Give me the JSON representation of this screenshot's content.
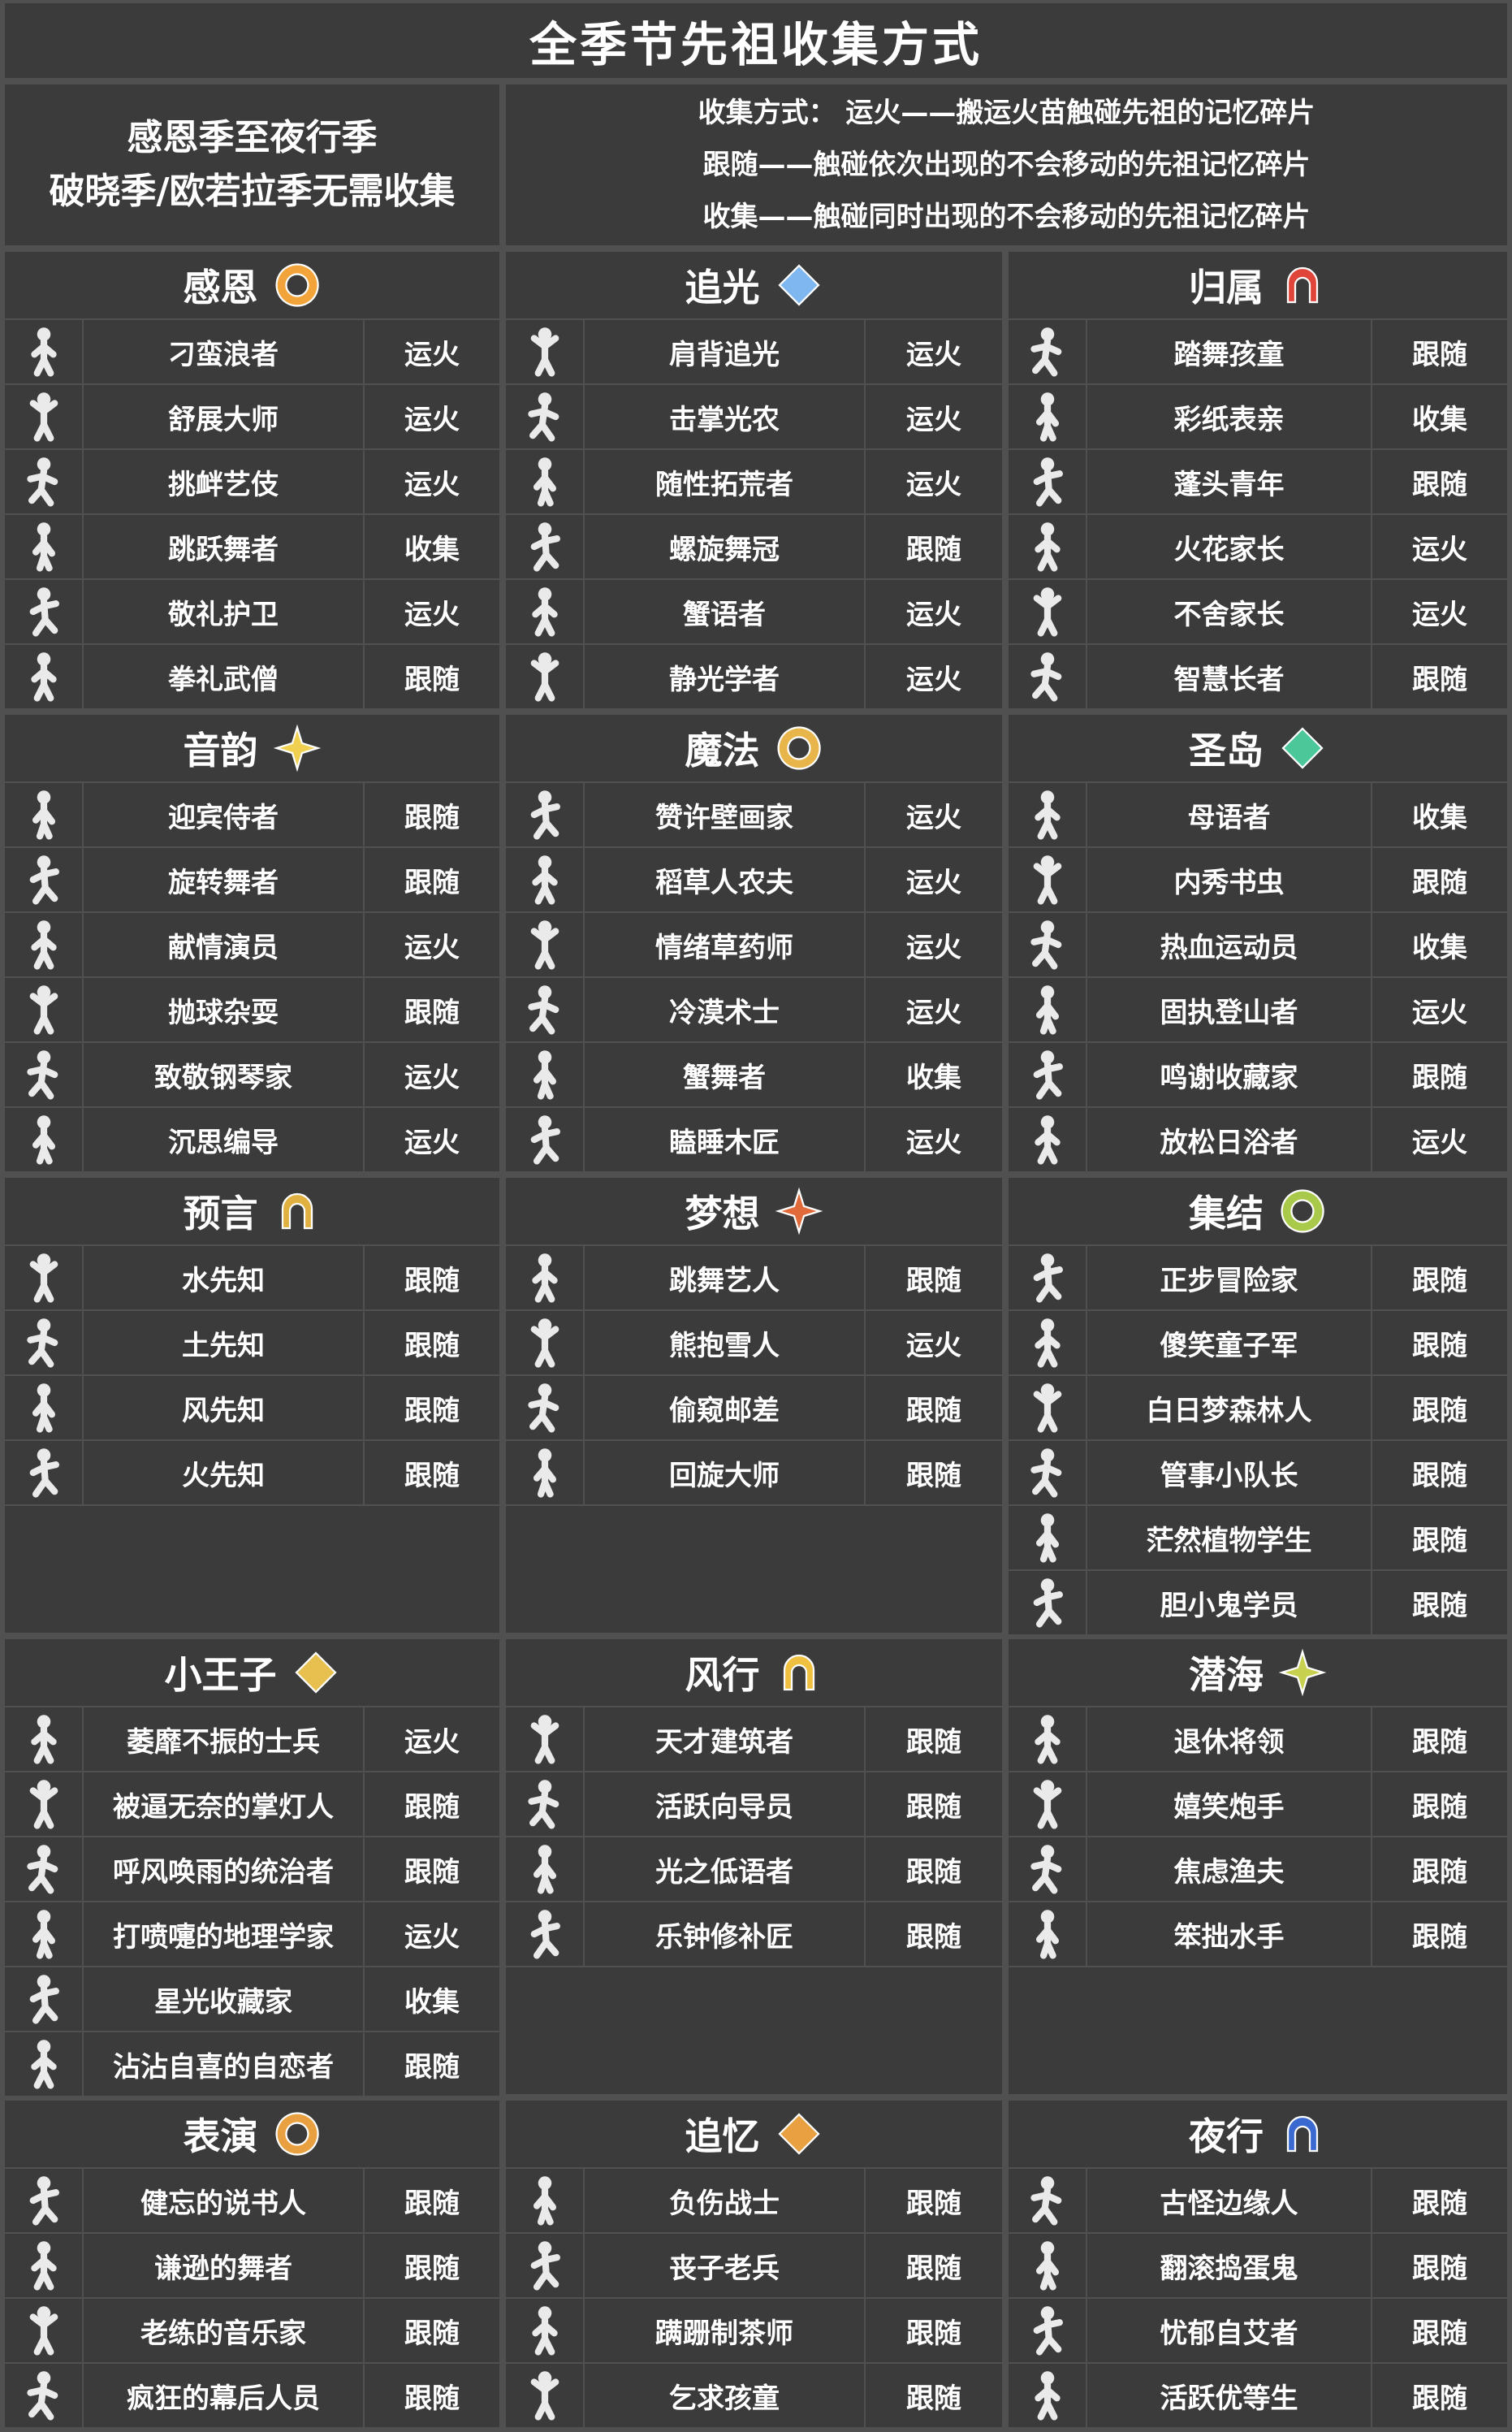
{
  "title": "全季节先祖收集方式",
  "intro_left": [
    "感恩季至夜行季",
    "破晓季/欧若拉季无需收集"
  ],
  "intro_right": [
    "收集方式： 运火——搬运火苗触碰先祖的记忆碎片",
    "跟随——触碰依次出现的不会移动的先祖记忆碎片",
    "收集——触碰同时出现的不会移动的先祖记忆碎片"
  ],
  "colors": {
    "background": "#3b3b3b",
    "grid_line": "#505050",
    "text": "#ffffff",
    "icon": "#eaeaea"
  },
  "sections": [
    [
      {
        "name": "感恩",
        "icon": "swirl-sun-emblem-icon",
        "icon_color": "#f2a43a",
        "ancestors": [
          {
            "name": "刁蛮浪者",
            "method": "运火"
          },
          {
            "name": "舒展大师",
            "method": "运火"
          },
          {
            "name": "挑衅艺伎",
            "method": "运火"
          },
          {
            "name": "跳跃舞者",
            "method": "收集"
          },
          {
            "name": "敬礼护卫",
            "method": "运火"
          },
          {
            "name": "拳礼武僧",
            "method": "跟随"
          }
        ]
      },
      {
        "name": "追光",
        "icon": "light-seeker-emblem-icon",
        "icon_color": "#7fb8f0",
        "ancestors": [
          {
            "name": "肩背追光",
            "method": "运火"
          },
          {
            "name": "击掌光农",
            "method": "运火"
          },
          {
            "name": "随性拓荒者",
            "method": "运火"
          },
          {
            "name": "螺旋舞冠",
            "method": "跟随"
          },
          {
            "name": "蟹语者",
            "method": "运火"
          },
          {
            "name": "静光学者",
            "method": "运火"
          }
        ]
      },
      {
        "name": "归属",
        "icon": "belonging-diamonds-icon",
        "icon_color": "#e0453a",
        "ancestors": [
          {
            "name": "踏舞孩童",
            "method": "跟随"
          },
          {
            "name": "彩纸表亲",
            "method": "收集"
          },
          {
            "name": "蓬头青年",
            "method": "跟随"
          },
          {
            "name": "火花家长",
            "method": "运火"
          },
          {
            "name": "不舍家长",
            "method": "运火"
          },
          {
            "name": "智慧长者",
            "method": "跟随"
          }
        ]
      }
    ],
    [
      {
        "name": "音韵",
        "icon": "rhythm-star-icon",
        "icon_color": "#f0d050",
        "ancestors": [
          {
            "name": "迎宾侍者",
            "method": "跟随"
          },
          {
            "name": "旋转舞者",
            "method": "跟随"
          },
          {
            "name": "献情演员",
            "method": "运火"
          },
          {
            "name": "抛球杂耍",
            "method": "跟随"
          },
          {
            "name": "致敬钢琴家",
            "method": "运火"
          },
          {
            "name": "沉思编导",
            "method": "运火"
          }
        ]
      },
      {
        "name": "魔法",
        "icon": "enchantment-ring-icon",
        "icon_color": "#e8b54a",
        "ancestors": [
          {
            "name": "赞许壁画家",
            "method": "运火"
          },
          {
            "name": "稻草人农夫",
            "method": "运火"
          },
          {
            "name": "情绪草药师",
            "method": "运火"
          },
          {
            "name": "冷漠术士",
            "method": "运火"
          },
          {
            "name": "蟹舞者",
            "method": "收集"
          },
          {
            "name": "瞌睡木匠",
            "method": "运火"
          }
        ]
      },
      {
        "name": "圣岛",
        "icon": "sanctuary-arch-icon",
        "icon_color": "#4cc79a",
        "ancestors": [
          {
            "name": "母语者",
            "method": "收集"
          },
          {
            "name": "内秀书虫",
            "method": "跟随"
          },
          {
            "name": "热血运动员",
            "method": "收集"
          },
          {
            "name": "固执登山者",
            "method": "运火"
          },
          {
            "name": "鸣谢收藏家",
            "method": "跟随"
          },
          {
            "name": "放松日浴者",
            "method": "运火"
          }
        ]
      }
    ],
    [
      {
        "name": "预言",
        "icon": "prophecy-star-icon",
        "icon_color": "#e0b040",
        "ancestors": [
          {
            "name": "水先知",
            "method": "跟随"
          },
          {
            "name": "土先知",
            "method": "跟随"
          },
          {
            "name": "风先知",
            "method": "跟随"
          },
          {
            "name": "火先知",
            "method": "跟随"
          }
        ]
      },
      {
        "name": "梦想",
        "icon": "dream-castle-icon",
        "icon_color": "#e06a3a",
        "ancestors": [
          {
            "name": "跳舞艺人",
            "method": "跟随"
          },
          {
            "name": "熊抱雪人",
            "method": "运火"
          },
          {
            "name": "偷窥邮差",
            "method": "跟随"
          },
          {
            "name": "回旋大师",
            "method": "跟随"
          }
        ]
      },
      {
        "name": "集结",
        "icon": "assembly-fleur-icon",
        "icon_color": "#a8c94a",
        "ancestors": [
          {
            "name": "正步冒险家",
            "method": "跟随"
          },
          {
            "name": "傻笑童子军",
            "method": "跟随"
          },
          {
            "name": "白日梦森林人",
            "method": "跟随"
          },
          {
            "name": "管事小队长",
            "method": "跟随"
          },
          {
            "name": "茫然植物学生",
            "method": "跟随"
          },
          {
            "name": "胆小鬼学员",
            "method": "跟随"
          }
        ]
      }
    ],
    [
      {
        "name": "小王子",
        "icon": "little-prince-emblem-icon",
        "icon_color": "#e8c050",
        "ancestors": [
          {
            "name": "萎靡不振的士兵",
            "method": "运火"
          },
          {
            "name": "被逼无奈的掌灯人",
            "method": "跟随"
          },
          {
            "name": "呼风唤雨的统治者",
            "method": "跟随"
          },
          {
            "name": "打喷嚏的地理学家",
            "method": "运火"
          },
          {
            "name": "星光收藏家",
            "method": "收集"
          },
          {
            "name": "沾沾自喜的自恋者",
            "method": "跟随"
          }
        ]
      },
      {
        "name": "风行",
        "icon": "flight-arrow-icon",
        "icon_color": "#f0c040",
        "ancestors": [
          {
            "name": "天才建筑者",
            "method": "跟随"
          },
          {
            "name": "活跃向导员",
            "method": "跟随"
          },
          {
            "name": "光之低语者",
            "method": "跟随"
          },
          {
            "name": "乐钟修补匠",
            "method": "跟随"
          }
        ]
      },
      {
        "name": "潜海",
        "icon": "abyss-wave-icon",
        "icon_color": "#c8d050",
        "ancestors": [
          {
            "name": "退休将领",
            "method": "跟随"
          },
          {
            "name": "嬉笑炮手",
            "method": "跟随"
          },
          {
            "name": "焦虑渔夫",
            "method": "跟随"
          },
          {
            "name": "笨拙水手",
            "method": "跟随"
          }
        ]
      }
    ],
    [
      {
        "name": "表演",
        "icon": "performance-mask-icon",
        "icon_color": "#e8a040",
        "ancestors": [
          {
            "name": "健忘的说书人",
            "method": "跟随"
          },
          {
            "name": "谦逊的舞者",
            "method": "跟随"
          },
          {
            "name": "老练的音乐家",
            "method": "跟随"
          },
          {
            "name": "疯狂的幕后人员",
            "method": "跟随"
          }
        ]
      },
      {
        "name": "追忆",
        "icon": "remembrance-shield-icon",
        "icon_color": "#e8a040",
        "ancestors": [
          {
            "name": "负伤战士",
            "method": "跟随"
          },
          {
            "name": "丧子老兵",
            "method": "跟随"
          },
          {
            "name": "蹒跚制茶师",
            "method": "跟随"
          },
          {
            "name": "乞求孩童",
            "method": "跟随"
          }
        ]
      },
      {
        "name": "夜行",
        "icon": "passage-hook-icon",
        "icon_color": "#3a6ad0",
        "ancestors": [
          {
            "name": "古怪边缘人",
            "method": "跟随"
          },
          {
            "name": "翻滚捣蛋鬼",
            "method": "跟随"
          },
          {
            "name": "忧郁自艾者",
            "method": "跟随"
          },
          {
            "name": "活跃优等生",
            "method": "跟随"
          }
        ]
      }
    ]
  ]
}
